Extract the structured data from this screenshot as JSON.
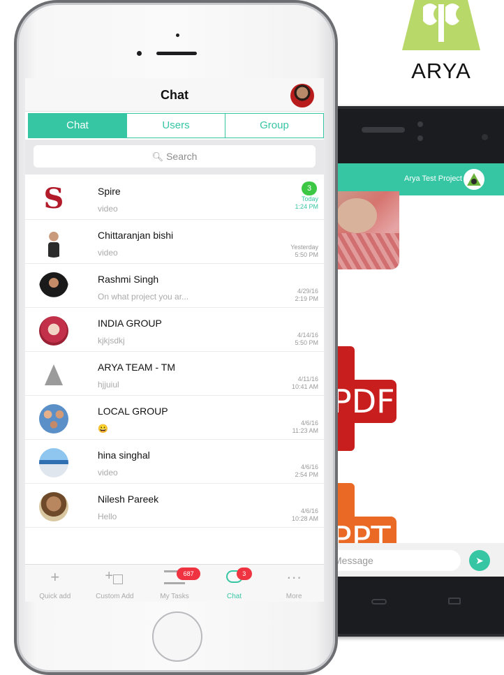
{
  "brand": {
    "name": "ARYA",
    "logo_color": "#b8d86a"
  },
  "back_screen": {
    "header_title": "Arya Test Project",
    "attachments": [
      {
        "type": "pdf",
        "label": "PDF",
        "color": "#c81e1e"
      },
      {
        "type": "ppt",
        "label": "PPT",
        "color": "#ea6a25"
      }
    ],
    "message_placeholder": "Message",
    "send_icon": "send-arrow-icon",
    "accent": "#36c6a4"
  },
  "chat_app": {
    "title": "Chat",
    "accent": "#36c6a4",
    "tabs": [
      {
        "label": "Chat",
        "active": true
      },
      {
        "label": "Users",
        "active": false
      },
      {
        "label": "Group",
        "active": false
      }
    ],
    "search": {
      "placeholder": "Search",
      "icon": "search-icon"
    },
    "conversations": [
      {
        "name": "Spire",
        "preview": "video",
        "date": "Today",
        "time": "1:24 PM",
        "unread": "3",
        "avatar": "s-logo"
      },
      {
        "name": "Chittaranjan bishi",
        "preview": "video",
        "date": "Yesterday",
        "time": "5:50 PM",
        "avatar": "man-photo"
      },
      {
        "name": "Rashmi Singh",
        "preview": "On what project you ar...",
        "date": "4/29/16",
        "time": "2:19 PM",
        "avatar": "woman-photo"
      },
      {
        "name": "INDIA GROUP",
        "preview": "kjkjsdkj",
        "date": "4/14/16",
        "time": "5:50 PM",
        "avatar": "group-photo"
      },
      {
        "name": "ARYA TEAM - TM",
        "preview": "hjjuiul",
        "date": "4/11/16",
        "time": "10:41 AM",
        "avatar": "arya-logo"
      },
      {
        "name": "LOCAL GROUP",
        "preview": "😀",
        "date": "4/6/16",
        "time": "11:23 AM",
        "avatar": "people-photo"
      },
      {
        "name": "hina singhal",
        "preview": "video",
        "date": "4/6/16",
        "time": "2:54 PM",
        "avatar": "landscape-photo"
      },
      {
        "name": "Nilesh Pareek",
        "preview": "Hello",
        "date": "4/6/16",
        "time": "10:28 AM",
        "avatar": "man-photo-2"
      }
    ],
    "bottom_nav": [
      {
        "label": "Quick add",
        "icon": "plus-icon"
      },
      {
        "label": "Custom Add",
        "icon": "plus-box-icon"
      },
      {
        "label": "My Tasks",
        "icon": "tasks-icon",
        "badge": "687"
      },
      {
        "label": "Chat",
        "icon": "chat-bubble-icon",
        "badge": "3",
        "active": true
      },
      {
        "label": "More",
        "icon": "more-dots-icon"
      }
    ]
  }
}
